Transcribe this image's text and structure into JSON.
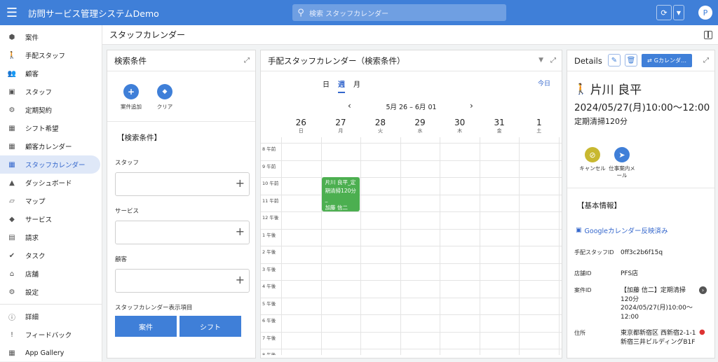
{
  "app": {
    "title": "訪問サービス管理システムDemo",
    "search_placeholder": "検索 スタッフカレンダー",
    "avatar_initial": "P"
  },
  "sidebar": {
    "items": [
      {
        "label": "案件",
        "icon": "cube-icon"
      },
      {
        "label": "手配スタッフ",
        "icon": "walk-icon"
      },
      {
        "label": "顧客",
        "icon": "people-icon"
      },
      {
        "label": "スタッフ",
        "icon": "badge-icon"
      },
      {
        "label": "定期契約",
        "icon": "bike-icon"
      },
      {
        "label": "シフト希望",
        "icon": "calendar-star-icon"
      },
      {
        "label": "顧客カレンダー",
        "icon": "calendar-grid-icon"
      },
      {
        "label": "スタッフカレンダー",
        "icon": "calendar-icon",
        "active": true
      },
      {
        "label": "ダッシュボード",
        "icon": "chart-icon"
      },
      {
        "label": "マップ",
        "icon": "map-icon"
      },
      {
        "label": "サービス",
        "icon": "tag-icon"
      },
      {
        "label": "請求",
        "icon": "invoice-icon"
      },
      {
        "label": "タスク",
        "icon": "check-icon"
      },
      {
        "label": "店舗",
        "icon": "store-icon"
      },
      {
        "label": "設定",
        "icon": "gear-icon"
      }
    ],
    "bottom": [
      {
        "label": "詳細",
        "icon": "info-icon"
      },
      {
        "label": "フィードバック",
        "icon": "feedback-icon"
      },
      {
        "label": "App Gallery",
        "icon": "grid-icon"
      }
    ]
  },
  "page": {
    "title": "スタッフカレンダー"
  },
  "search_panel": {
    "title": "検索条件",
    "add_label": "案件追加",
    "clear_label": "クリア",
    "section": "【検索条件】",
    "staff_label": "スタッフ",
    "service_label": "サービス",
    "customer_label": "顧客",
    "display_label": "スタッフカレンダー表示項目",
    "btn_case": "案件",
    "btn_shift": "シフト"
  },
  "calendar": {
    "title": "手配スタッフカレンダー（検索条件）",
    "tabs": [
      "日",
      "週",
      "月"
    ],
    "active_tab": "週",
    "today": "今日",
    "range": "5月 26 – 6月 01",
    "days": [
      {
        "num": "26",
        "wd": "日"
      },
      {
        "num": "27",
        "wd": "月"
      },
      {
        "num": "28",
        "wd": "火"
      },
      {
        "num": "29",
        "wd": "水"
      },
      {
        "num": "30",
        "wd": "木"
      },
      {
        "num": "31",
        "wd": "金"
      },
      {
        "num": "1",
        "wd": "土"
      }
    ],
    "hours": [
      "8 午前",
      "9 午前",
      "10 午前",
      "11 午前",
      "12 午後",
      "1 午後",
      "2 午後",
      "3 午後",
      "4 午後",
      "5 午後",
      "6 午後",
      "7 午後",
      "8 午後"
    ],
    "event": {
      "line1": "片川 良平_定",
      "line2": "期清掃120分_",
      "line3": "加藤 信二",
      "color": "#4caf50"
    }
  },
  "details": {
    "title": "Details",
    "gcal_btn": "Gカレンダ…",
    "name": "片川 良平",
    "datetime": "2024/05/27(月)10:00～12:00",
    "service": "定期清掃120分",
    "cancel_label": "キャンセル",
    "mail_label": "仕事案内メール",
    "section": "【基本情報】",
    "gcal_status": "Googleカレンダー反映済み",
    "fields": {
      "staff_id_k": "手配スタッフID",
      "staff_id_v": "0ff3c2b6f15q",
      "store_id_k": "店舗ID",
      "store_id_v": "PFS店",
      "case_id_k": "案件ID",
      "case_id_v": "【加藤 信二】定期清掃120分 2024/05/27(月)10:00～12:00",
      "addr_k": "住所",
      "addr_v": "東京都新宿区 西新宿2-1-1 新宿三井ビルディングB1F"
    }
  }
}
